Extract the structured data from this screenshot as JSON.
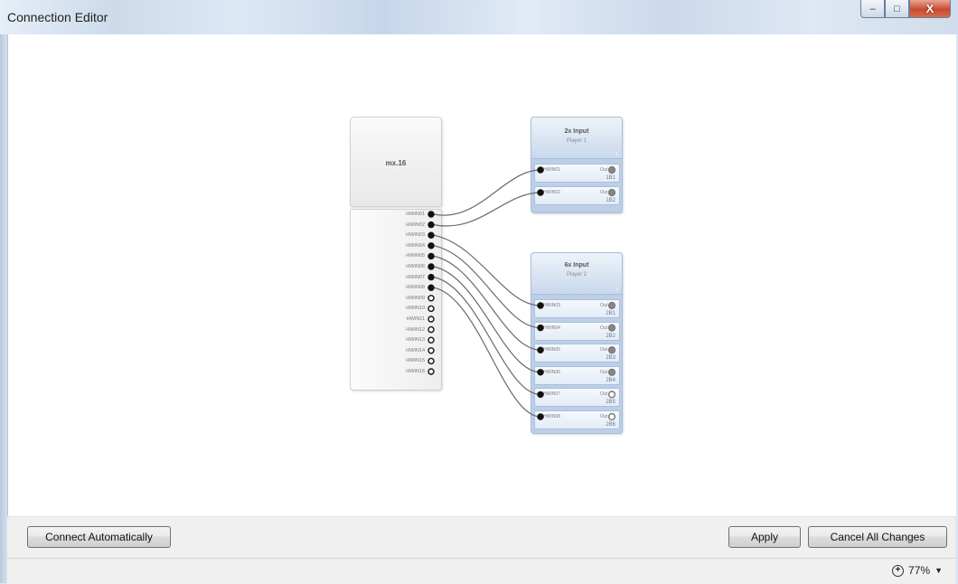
{
  "window": {
    "title": "Connection Editor",
    "minimize_label": "–",
    "maximize_label": "□",
    "close_label": "X"
  },
  "mixer": {
    "name": "mx.16",
    "ports": [
      "HWIN01",
      "HWIN02",
      "HWIN03",
      "HWIN04",
      "HWIN05",
      "HWIN06",
      "HWIN07",
      "HWIN08",
      "HWIN09",
      "HWIN10",
      "HWIN11",
      "HWIN12",
      "HWIN13",
      "HWIN14",
      "HWIN15",
      "HWIN16"
    ],
    "connected_count": 8
  },
  "players": [
    {
      "title": "2x Input",
      "subtitle": "Player 1",
      "number": "1",
      "channels": [
        {
          "input": "HWIN01",
          "out": "Out",
          "code": "1B1",
          "out_connected": true
        },
        {
          "input": "HWIN02",
          "out": "Out",
          "code": "1B2",
          "out_connected": true
        }
      ]
    },
    {
      "title": "6x Input",
      "subtitle": "Player 2",
      "number": "2",
      "channels": [
        {
          "input": "HWIN03",
          "out": "Out",
          "code": "2B1",
          "out_connected": true
        },
        {
          "input": "HWIN04",
          "out": "Out",
          "code": "2B2",
          "out_connected": true
        },
        {
          "input": "HWIN05",
          "out": "Out",
          "code": "2B3",
          "out_connected": true
        },
        {
          "input": "HWIN06",
          "out": "Out",
          "code": "2B4",
          "out_connected": true
        },
        {
          "input": "HWIN07",
          "out": "Out",
          "code": "2B5",
          "out_connected": false
        },
        {
          "input": "HWIN08",
          "out": "Out",
          "code": "2B6",
          "out_connected": false
        }
      ]
    }
  ],
  "buttons": {
    "connect_auto": "Connect Automatically",
    "apply": "Apply",
    "cancel": "Cancel All Changes"
  },
  "status": {
    "zoom": "77%",
    "zoom_icon": "zoom-in-icon"
  }
}
